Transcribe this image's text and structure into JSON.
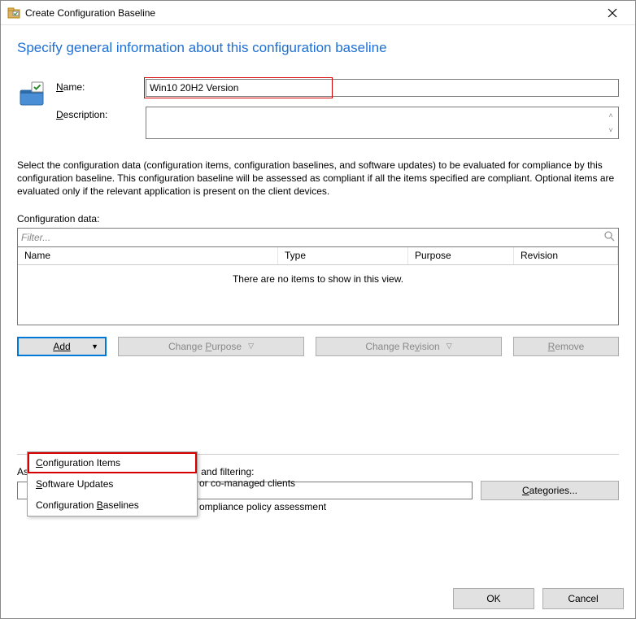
{
  "titlebar": {
    "title": "Create Configuration Baseline"
  },
  "heading": "Specify general information about this configuration baseline",
  "labels": {
    "name_prefix": "N",
    "name_rest": "ame:",
    "desc_prefix": "D",
    "desc_rest": "escription:",
    "config_data_prefix": "C",
    "config_data_rest": "onfiguration data:",
    "categories_label": "Assigned categories to improve searching and filtering:"
  },
  "values": {
    "name": "Win10 20H2 Version",
    "description": "",
    "filter_placeholder": "Filter...",
    "empty_grid": "There are no items to show in this view."
  },
  "explain": "Select the configuration data (configuration items, configuration baselines, and software updates) to be evaluated for compliance by this configuration baseline. This configuration baseline will be assessed as compliant if all the items specified are compliant. Optional items are evaluated only if the relevant application is present on  the client devices.",
  "grid": {
    "columns": {
      "name": "Name",
      "type": "Type",
      "purpose": "Purpose",
      "revision": "Revision"
    }
  },
  "buttons": {
    "add": "Add",
    "change_purpose": "Change Purpose",
    "change_revision": "Change Revision",
    "remove": "Remove",
    "categories": "Categories...",
    "ok": "OK",
    "cancel": "Cancel"
  },
  "menu": {
    "items": [
      "Configuration Items",
      "Software Updates",
      "Configuration Baselines"
    ]
  },
  "obscured": {
    "co_managed": "or co-managed clients",
    "compliance": "ompliance policy assessment"
  }
}
